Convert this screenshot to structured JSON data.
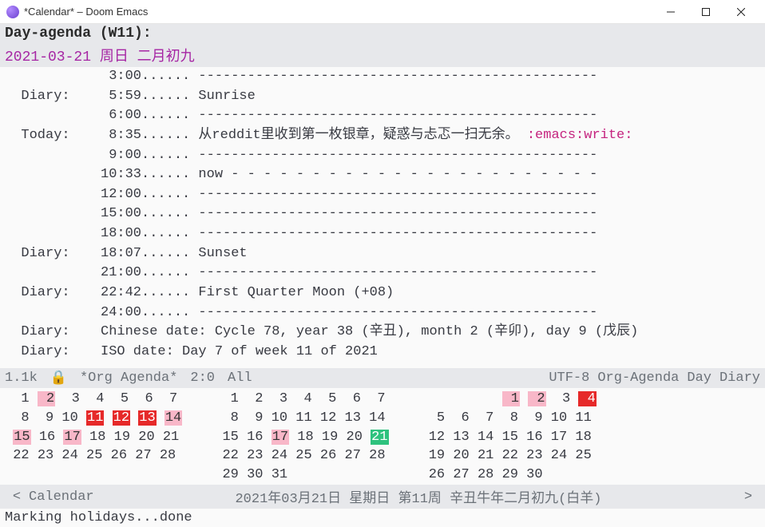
{
  "window": {
    "title": "*Calendar* – Doom Emacs"
  },
  "agenda": {
    "header": "Day-agenda (W11):",
    "date_line": "2021-03-21 周日  二月初九",
    "lines": [
      {
        "cat": "",
        "time": " 3:00",
        "dots": "...... ",
        "text": "-------------------------------------------------",
        "tags": ""
      },
      {
        "cat": "Diary:",
        "time": " 5:59",
        "dots": "...... ",
        "text": "Sunrise",
        "tags": ""
      },
      {
        "cat": "",
        "time": " 6:00",
        "dots": "...... ",
        "text": "-------------------------------------------------",
        "tags": ""
      },
      {
        "cat": "Today:",
        "time": " 8:35",
        "dots": "...... ",
        "text": "从reddit里收到第一枚银章，疑惑与忐忑一扫无余。",
        "tags": ":emacs:write:"
      },
      {
        "cat": "",
        "time": " 9:00",
        "dots": "...... ",
        "text": "-------------------------------------------------",
        "tags": ""
      },
      {
        "cat": "",
        "time": "10:33",
        "dots": "...... ",
        "text": "now - - - - - - - - - - - - - - - - - - - - - - -",
        "tags": ""
      },
      {
        "cat": "",
        "time": "12:00",
        "dots": "...... ",
        "text": "-------------------------------------------------",
        "tags": ""
      },
      {
        "cat": "",
        "time": "15:00",
        "dots": "...... ",
        "text": "-------------------------------------------------",
        "tags": ""
      },
      {
        "cat": "",
        "time": "18:00",
        "dots": "...... ",
        "text": "-------------------------------------------------",
        "tags": ""
      },
      {
        "cat": "Diary:",
        "time": "18:07",
        "dots": "...... ",
        "text": "Sunset",
        "tags": ""
      },
      {
        "cat": "",
        "time": "21:00",
        "dots": "...... ",
        "text": "-------------------------------------------------",
        "tags": ""
      },
      {
        "cat": "Diary:",
        "time": "22:42",
        "dots": "...... ",
        "text": "First Quarter Moon (+08)",
        "tags": ""
      },
      {
        "cat": "",
        "time": "24:00",
        "dots": "...... ",
        "text": "-------------------------------------------------",
        "tags": ""
      },
      {
        "cat": "Diary:",
        "time": "",
        "dots": "",
        "text": "Chinese date: Cycle 78, year 38 (辛丑), month 2 (辛卯), day 9 (戊辰)",
        "tags": ""
      },
      {
        "cat": "Diary:",
        "time": "",
        "dots": "",
        "text": "ISO date: Day 7 of week 11 of 2021",
        "tags": ""
      }
    ]
  },
  "modeline": {
    "size": "1.1k",
    "lock": "🔒",
    "buffer": "*Org Agenda*",
    "cursor": "2:0",
    "all": "All",
    "encoding": "UTF-8",
    "mode": "Org-Agenda",
    "day": "Day",
    "diary": "Diary"
  },
  "calendar": {
    "months": [
      {
        "rows": [
          {
            "cells": [
              {
                "t": " 1"
              },
              {
                "t": " 2",
                "c": "pink"
              },
              {
                "t": " 3"
              },
              {
                "t": " 4"
              },
              {
                "t": " 5"
              },
              {
                "t": " 6"
              },
              {
                "t": " 7"
              }
            ]
          },
          {
            "cells": [
              {
                "t": " 8"
              },
              {
                "t": " 9"
              },
              {
                "t": "10"
              },
              {
                "t": "11",
                "c": "red"
              },
              {
                "t": "12",
                "c": "red"
              },
              {
                "t": "13",
                "c": "red"
              },
              {
                "t": "14",
                "c": "pink"
              }
            ]
          },
          {
            "cells": [
              {
                "t": "15",
                "c": "pink"
              },
              {
                "t": "16"
              },
              {
                "t": "17",
                "c": "pink"
              },
              {
                "t": "18"
              },
              {
                "t": "19"
              },
              {
                "t": "20"
              },
              {
                "t": "21"
              }
            ]
          },
          {
            "cells": [
              {
                "t": "22"
              },
              {
                "t": "23"
              },
              {
                "t": "24"
              },
              {
                "t": "25"
              },
              {
                "t": "26"
              },
              {
                "t": "27"
              },
              {
                "t": "28"
              }
            ]
          }
        ]
      },
      {
        "rows": [
          {
            "cells": [
              {
                "t": " 1"
              },
              {
                "t": " 2"
              },
              {
                "t": " 3"
              },
              {
                "t": " 4"
              },
              {
                "t": " 5"
              },
              {
                "t": " 6"
              },
              {
                "t": " 7"
              }
            ]
          },
          {
            "cells": [
              {
                "t": " 8"
              },
              {
                "t": " 9"
              },
              {
                "t": "10"
              },
              {
                "t": "11"
              },
              {
                "t": "12"
              },
              {
                "t": "13"
              },
              {
                "t": "14"
              }
            ]
          },
          {
            "cells": [
              {
                "t": "15"
              },
              {
                "t": "16"
              },
              {
                "t": "17",
                "c": "pink"
              },
              {
                "t": "18"
              },
              {
                "t": "19"
              },
              {
                "t": "20"
              },
              {
                "t": "21",
                "c": "green"
              }
            ]
          },
          {
            "cells": [
              {
                "t": "22"
              },
              {
                "t": "23"
              },
              {
                "t": "24"
              },
              {
                "t": "25"
              },
              {
                "t": "26"
              },
              {
                "t": "27"
              },
              {
                "t": "28"
              }
            ]
          },
          {
            "cells": [
              {
                "t": "29"
              },
              {
                "t": "30"
              },
              {
                "t": "31"
              }
            ]
          }
        ]
      },
      {
        "rows": [
          {
            "cells": [
              {
                "t": "  "
              },
              {
                "t": "  "
              },
              {
                "t": "  "
              },
              {
                "t": " 1",
                "c": "pink"
              },
              {
                "t": " 2",
                "c": "pink"
              },
              {
                "t": " 3"
              },
              {
                "t": " 4",
                "c": "red"
              }
            ]
          },
          {
            "cells": [
              {
                "t": " 5"
              },
              {
                "t": " 6"
              },
              {
                "t": " 7"
              },
              {
                "t": " 8"
              },
              {
                "t": " 9"
              },
              {
                "t": "10"
              },
              {
                "t": "11"
              }
            ]
          },
          {
            "cells": [
              {
                "t": "12"
              },
              {
                "t": "13"
              },
              {
                "t": "14"
              },
              {
                "t": "15"
              },
              {
                "t": "16"
              },
              {
                "t": "17"
              },
              {
                "t": "18"
              }
            ]
          },
          {
            "cells": [
              {
                "t": "19"
              },
              {
                "t": "20"
              },
              {
                "t": "21"
              },
              {
                "t": "22"
              },
              {
                "t": "23"
              },
              {
                "t": "24"
              },
              {
                "t": "25"
              }
            ]
          },
          {
            "cells": [
              {
                "t": "26"
              },
              {
                "t": "27"
              },
              {
                "t": "28"
              },
              {
                "t": "29"
              },
              {
                "t": "30"
              }
            ]
          }
        ]
      }
    ]
  },
  "cal_modeline": {
    "left_arrow": "<",
    "buffer": "Calendar",
    "center": "2021年03月21日  星期日  第11周    辛丑牛年二月初九(白羊)",
    "right_arrow": ">"
  },
  "echo": {
    "text": "Marking holidays...done"
  }
}
